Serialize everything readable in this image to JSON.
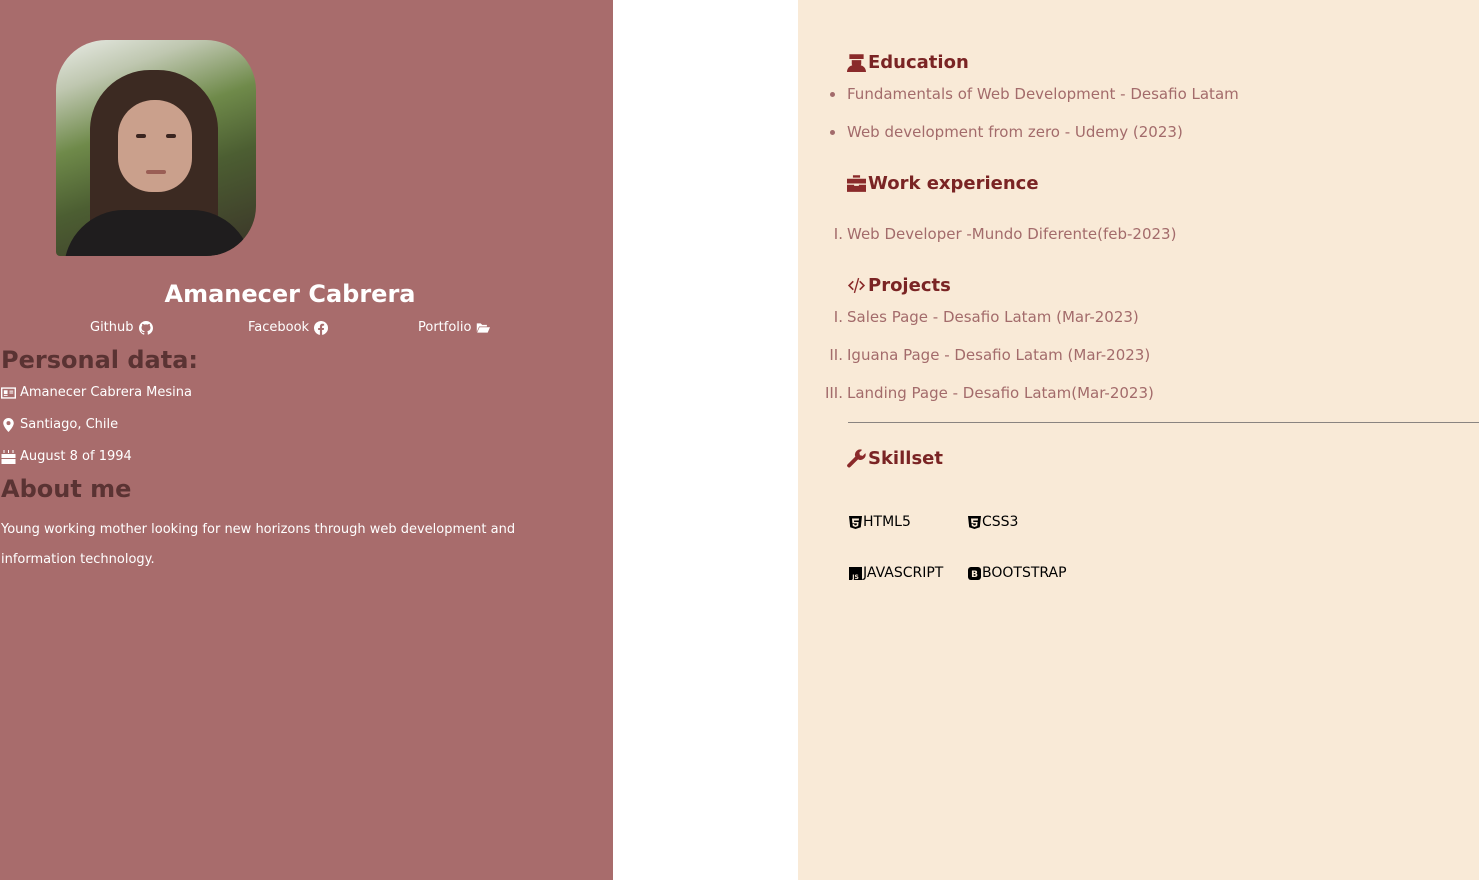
{
  "profile": {
    "name": "Amanecer Cabrera",
    "links": [
      {
        "label": "Github",
        "icon": "github-icon"
      },
      {
        "label": "Facebook",
        "icon": "facebook-icon"
      },
      {
        "label": "Portfolio",
        "icon": "folder-open-icon"
      }
    ]
  },
  "personal": {
    "heading": "Personal data:",
    "full_name": "Amanecer Cabrera Mesina",
    "location": "Santiago, Chile",
    "birthday": "August 8 of 1994"
  },
  "about": {
    "heading": "About me",
    "text": "Young working mother looking for new horizons through web development and information technology."
  },
  "education": {
    "heading": "Education",
    "items": [
      "Fundamentals of Web Development - Desafio Latam",
      "Web development from zero - Udemy (2023)"
    ]
  },
  "work": {
    "heading": "Work experience",
    "markers": [
      "I."
    ],
    "items": [
      "Web Developer -Mundo Diferente(feb-2023)"
    ]
  },
  "projects": {
    "heading": "Projects",
    "markers": [
      "I.",
      "II.",
      "III."
    ],
    "items": [
      "Sales Page - Desafio Latam (Mar-2023)",
      "Iguana Page - Desafio Latam (Mar-2023)",
      "Landing Page - Desafio Latam(Mar-2023)"
    ]
  },
  "skills": {
    "heading": "Skillset",
    "items": [
      "HTML5",
      "CSS3",
      "JAVASCRIPT",
      "BOOTSTRAP"
    ]
  },
  "colors": {
    "sidebar_bg": "#a86c6c",
    "content_bg": "#f9ead7",
    "accent": "#7a2424",
    "muted_text": "#a36b6b",
    "heading_dark": "#5a3333"
  }
}
